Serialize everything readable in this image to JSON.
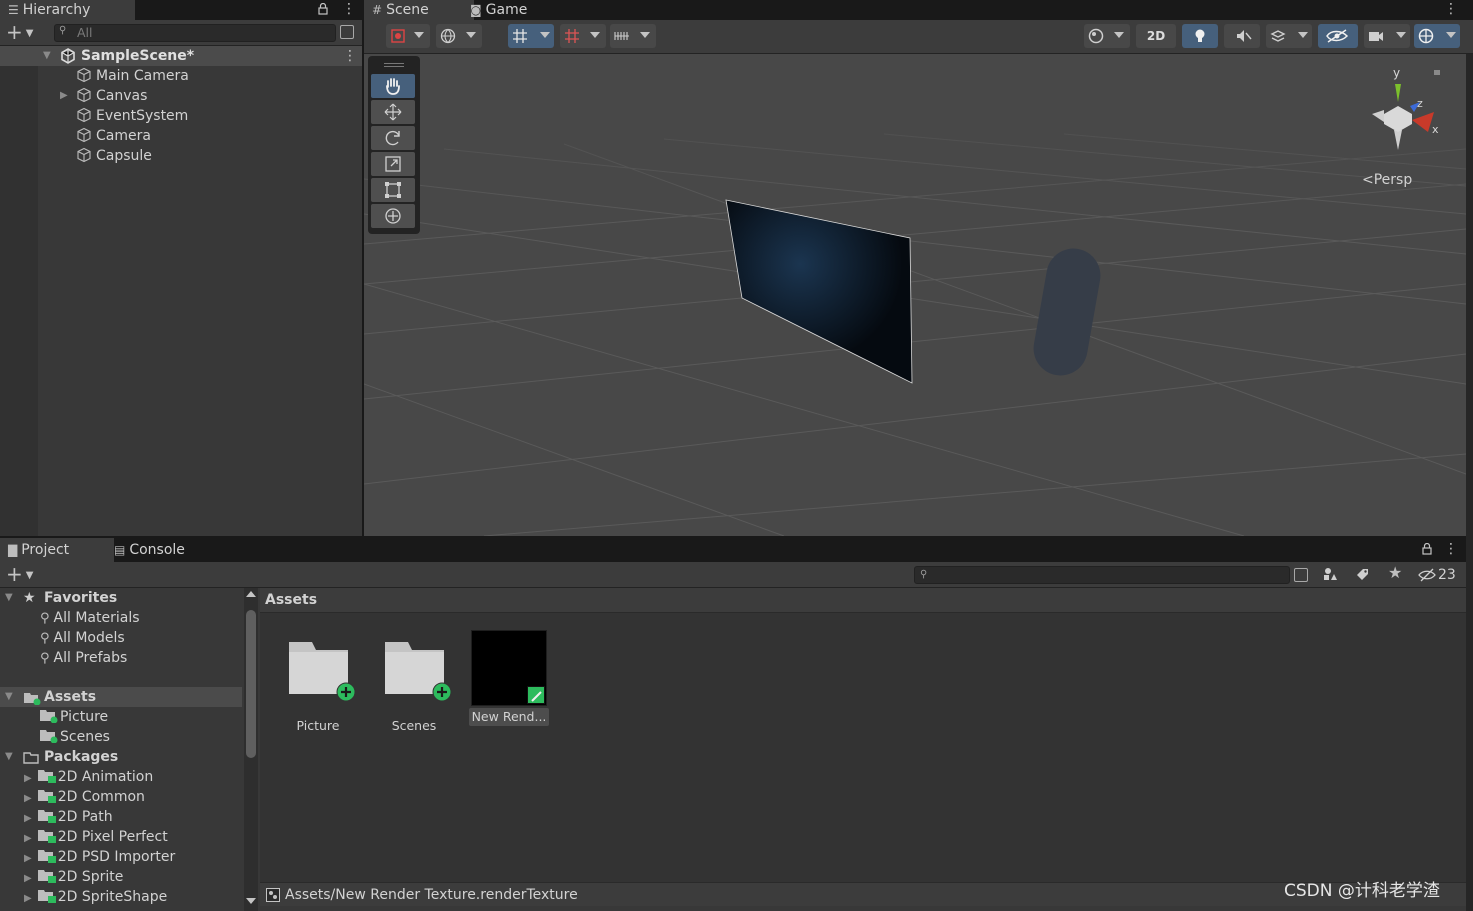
{
  "hierarchy": {
    "tab_label": "Hierarchy",
    "search_placeholder": "All",
    "scene_name": "SampleScene*",
    "items": [
      {
        "label": "Main Camera"
      },
      {
        "label": "Canvas"
      },
      {
        "label": "EventSystem"
      },
      {
        "label": "Camera"
      },
      {
        "label": "Capsule"
      }
    ]
  },
  "scene_view": {
    "tabs": [
      {
        "label": "Scene"
      },
      {
        "label": "Game"
      }
    ],
    "mode_2d_label": "2D",
    "projection_label": "Persp",
    "gizmo_axes": {
      "x": "x",
      "y": "y",
      "z": "z"
    }
  },
  "project": {
    "tabs": [
      {
        "label": "Project"
      },
      {
        "label": "Console"
      }
    ],
    "hidden_count": "23",
    "breadcrumb": "Assets",
    "favorites": {
      "label": "Favorites",
      "items": [
        {
          "label": "All Materials"
        },
        {
          "label": "All Models"
        },
        {
          "label": "All Prefabs"
        }
      ]
    },
    "assets_tree": {
      "label": "Assets",
      "items": [
        {
          "label": "Picture"
        },
        {
          "label": "Scenes"
        }
      ]
    },
    "packages_tree": {
      "label": "Packages",
      "items": [
        {
          "label": "2D Animation"
        },
        {
          "label": "2D Common"
        },
        {
          "label": "2D Path"
        },
        {
          "label": "2D Pixel Perfect"
        },
        {
          "label": "2D PSD Importer"
        },
        {
          "label": "2D Sprite"
        },
        {
          "label": "2D SpriteShape"
        }
      ]
    },
    "grid_items": [
      {
        "label": "Picture"
      },
      {
        "label": "Scenes"
      },
      {
        "label": "New Rend..."
      }
    ],
    "status_path": "Assets/New Render Texture.renderTexture"
  },
  "watermark": "CSDN @计科老学渣",
  "colors": {
    "panel": "#383838",
    "tab_active": "#3c3c3c",
    "selection": "#46607c",
    "package_badge": "#2dbb5d"
  }
}
